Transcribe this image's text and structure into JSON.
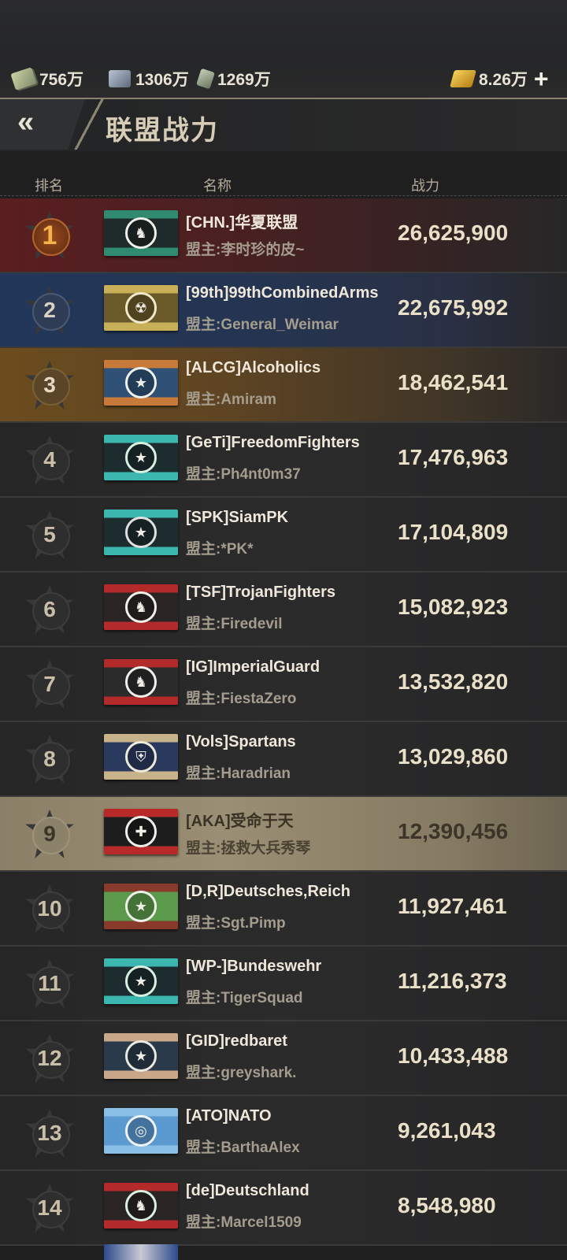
{
  "resources": [
    {
      "icon": "cash-icon",
      "value": "756万"
    },
    {
      "icon": "steel-icon",
      "value": "1306万"
    },
    {
      "icon": "fuel-icon",
      "value": "1269万"
    }
  ],
  "gold": {
    "icon": "gold-icon",
    "value": "8.26万",
    "add_label": "+"
  },
  "header": {
    "back_label": "«",
    "title": "联盟战力"
  },
  "columns": {
    "rank": "排名",
    "name": "名称",
    "power": "战力"
  },
  "rows": [
    {
      "rank": "1",
      "name": "[CHN.]华夏联盟",
      "leader": "盟主:李时珍的皮~",
      "power": "26,625,900",
      "flag": [
        "#1f2a2a",
        "#2f8a70",
        "#f0f0ea"
      ],
      "emblem": "lion-emblem-icon"
    },
    {
      "rank": "2",
      "name": "[99th]99thCombinedArms",
      "leader": "盟主:General_Weimar",
      "power": "22,675,992",
      "flag": [
        "#6a5a2a",
        "#c8b058",
        "#f0e8c8"
      ],
      "emblem": "radiation-emblem-icon"
    },
    {
      "rank": "3",
      "name": "[ALCG]Alcoholics",
      "leader": "盟主:Amiram",
      "power": "18,462,541",
      "flag": [
        "#2f5176",
        "#c87a3a",
        "#f0f0ea"
      ],
      "emblem": "star-emblem-icon"
    },
    {
      "rank": "4",
      "name": "[GeTi]FreedomFighters",
      "leader": "盟主:Ph4nt0m37",
      "power": "17,476,963",
      "flag": [
        "#1d2d2f",
        "#3bb7b0",
        "#d8f0e0"
      ],
      "emblem": "star-emblem-icon"
    },
    {
      "rank": "5",
      "name": "[SPK]SiamPK",
      "leader": "盟主:*PK*",
      "power": "17,104,809",
      "flag": [
        "#1d2d2f",
        "#3bb7b0",
        "#e0e0e0"
      ],
      "emblem": "star-emblem-icon"
    },
    {
      "rank": "6",
      "name": "[TSF]TrojanFighters",
      "leader": "盟主:Firedevil",
      "power": "15,082,923",
      "flag": [
        "#2b2425",
        "#b22a2a",
        "#f0f0ea"
      ],
      "emblem": "lion-emblem-icon"
    },
    {
      "rank": "7",
      "name": "[IG]ImperialGuard",
      "leader": "盟主:FiestaZero",
      "power": "13,532,820",
      "flag": [
        "#2b2b2c",
        "#b22a2a",
        "#f0f0ea"
      ],
      "emblem": "lion-emblem-icon"
    },
    {
      "rank": "8",
      "name": "[Vols]Spartans",
      "leader": "盟主:Haradrian",
      "power": "13,029,860",
      "flag": [
        "#2a3a5e",
        "#c8b28a",
        "#f0e8d8"
      ],
      "emblem": "helmet-emblem-icon"
    },
    {
      "rank": "9",
      "name": "[AKA]受命于天",
      "leader": "盟主:拯救大兵秀琴",
      "power": "12,390,456",
      "flag": [
        "#1d1d1d",
        "#b82a2a",
        "#f0f0ea"
      ],
      "emblem": "cross-emblem-icon"
    },
    {
      "rank": "10",
      "name": "[D,R]Deutsches,Reich",
      "leader": "盟主:Sgt.Pimp",
      "power": "11,927,461",
      "flag": [
        "#5a9a4a",
        "#8a3a2a",
        "#f0f0ea"
      ],
      "emblem": "star-emblem-icon"
    },
    {
      "rank": "11",
      "name": "[WP-]Bundeswehr",
      "leader": "盟主:TigerSquad",
      "power": "11,216,373",
      "flag": [
        "#1d2d2f",
        "#3bb7b0",
        "#d8f0e0"
      ],
      "emblem": "star-emblem-icon"
    },
    {
      "rank": "12",
      "name": "[GID]redbaret",
      "leader": "盟主:greyshark.",
      "power": "10,433,488",
      "flag": [
        "#2a3a4a",
        "#c8a888",
        "#e8e8e0"
      ],
      "emblem": "star-emblem-icon"
    },
    {
      "rank": "13",
      "name": "[ATO]NATO",
      "leader": "盟主:BarthaAlex",
      "power": "9,261,043",
      "flag": [
        "#5a9ad0",
        "#8ac0e8",
        "#f0f4fa"
      ],
      "emblem": "un-emblem-icon"
    },
    {
      "rank": "14",
      "name": "[de]Deutschland",
      "leader": "盟主:Marcel1509",
      "power": "8,548,980",
      "flag": [
        "#2b2425",
        "#b22a2a",
        "#d8f0e0"
      ],
      "emblem": "lion-emblem-icon"
    }
  ]
}
